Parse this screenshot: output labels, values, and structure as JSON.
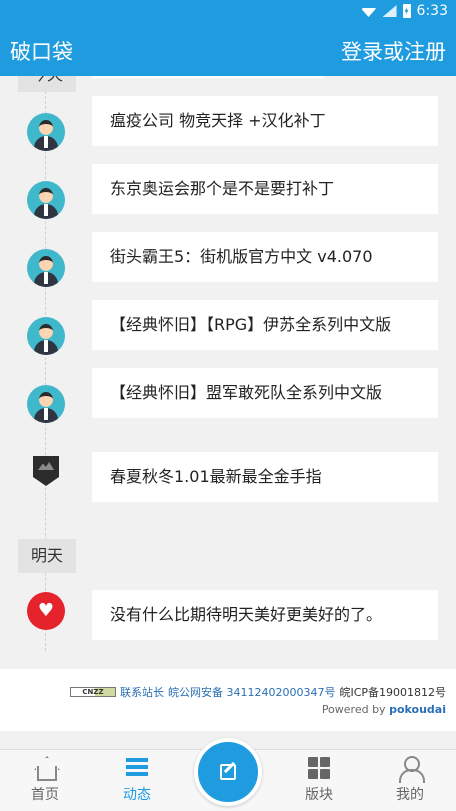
{
  "status_bar": {
    "time": "6:33"
  },
  "app_bar": {
    "title": "破口袋",
    "login": "登录或注册"
  },
  "timeline": {
    "partial_day_label": "今天",
    "items": [
      {
        "title": "瘟疫公司 物竞天择 +汉化补丁",
        "icon": "user-avatar-icon"
      },
      {
        "title": "东京奥运会那个是不是要打补丁",
        "icon": "user-avatar-icon"
      },
      {
        "title": "街头霸王5：街机版官方中文 v4.070",
        "icon": "user-avatar-icon"
      },
      {
        "title": "【经典怀旧】【RPG】伊苏全系列中文版",
        "icon": "user-avatar-icon"
      },
      {
        "title": "【经典怀旧】盟军敢死队全系列中文版",
        "icon": "user-avatar-icon"
      },
      {
        "title": "春夏秋冬1.01最新最全金手指",
        "icon": "shield-icon"
      }
    ],
    "tomorrow": {
      "label": "明天",
      "item": {
        "title": "没有什么比期待明天美好更美好的了。",
        "icon": "heart-icon"
      }
    }
  },
  "footer": {
    "badge": "CNZZ",
    "contact": "联系站长",
    "police": "皖公网安备 34112402000347号",
    "icp": "皖ICP备19001812号",
    "powered_by": "Powered by",
    "brand": "pokoudai"
  },
  "tab_bar": {
    "tabs": [
      {
        "label": "首页",
        "icon": "home-icon"
      },
      {
        "label": "动态",
        "icon": "list-icon",
        "active": true
      },
      {
        "label": "版块",
        "icon": "grid-icon"
      },
      {
        "label": "我的",
        "icon": "user-icon"
      }
    ],
    "fab_icon": "edit-icon"
  },
  "colors": {
    "primary": "#1f9be0",
    "heart": "#e5232d",
    "avatar": "#40b8cc"
  }
}
